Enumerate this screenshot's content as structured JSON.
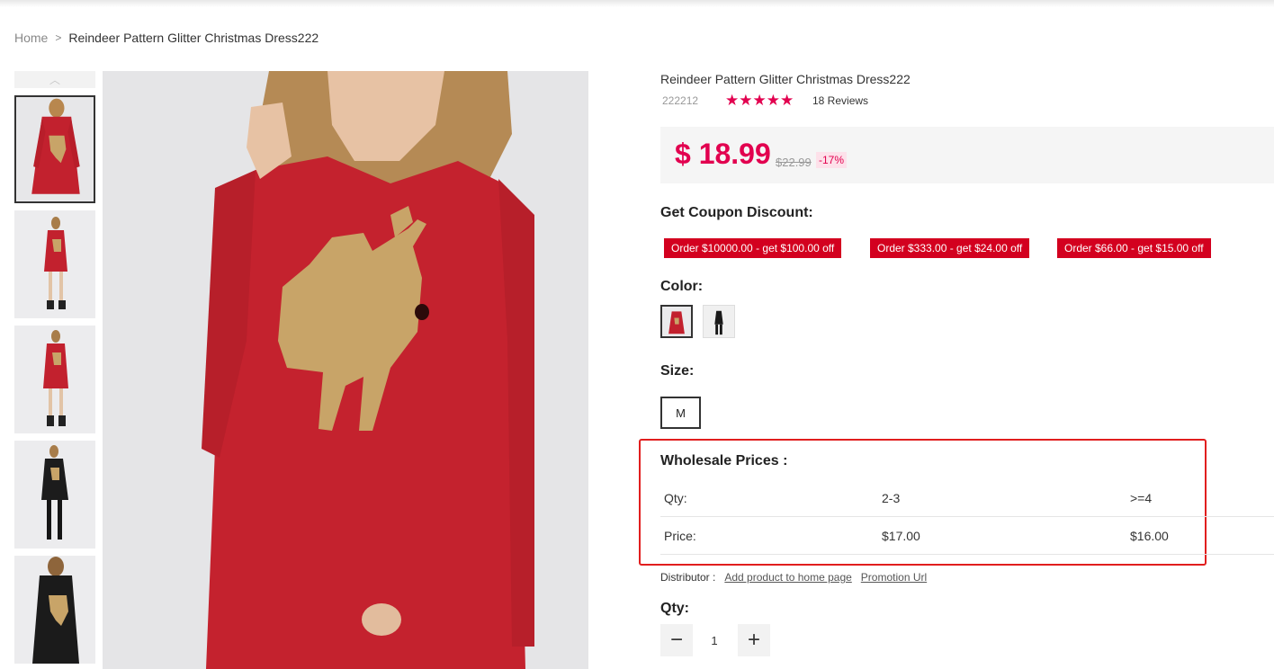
{
  "breadcrumb": {
    "home": "Home",
    "separator": ">",
    "current": "Reindeer Pattern Glitter Christmas Dress222"
  },
  "product": {
    "title": "Reindeer Pattern Glitter Christmas Dress222",
    "sku": "222212",
    "stars": "★★★★★",
    "reviews": "18 Reviews",
    "price": "$ 18.99",
    "old_price": "$22.99",
    "discount": "-17%"
  },
  "coupon": {
    "heading": "Get Coupon Discount:",
    "items": [
      "Order $10000.00 - get $100.00 off",
      "Order $333.00 - get $24.00 off",
      "Order $66.00 - get $15.00 off"
    ]
  },
  "color": {
    "label": "Color:"
  },
  "size": {
    "label": "Size:",
    "selected": "M"
  },
  "wholesale": {
    "title": "Wholesale Prices :",
    "qty_label": "Qty:",
    "qty_values": [
      "2-3",
      ">=4"
    ],
    "price_label": "Price:",
    "price_values": [
      "$17.00",
      "$16.00"
    ]
  },
  "distributor": {
    "label": "Distributor :",
    "add_link": "Add product to home page",
    "promo_link": "Promotion Url"
  },
  "quantity": {
    "label": "Qty:",
    "value": "1",
    "minus": "−",
    "plus": "+"
  },
  "colors": {
    "accent": "#e2004f",
    "coupon_bg": "#d3001f",
    "highlight_border": "#e11e1e"
  }
}
